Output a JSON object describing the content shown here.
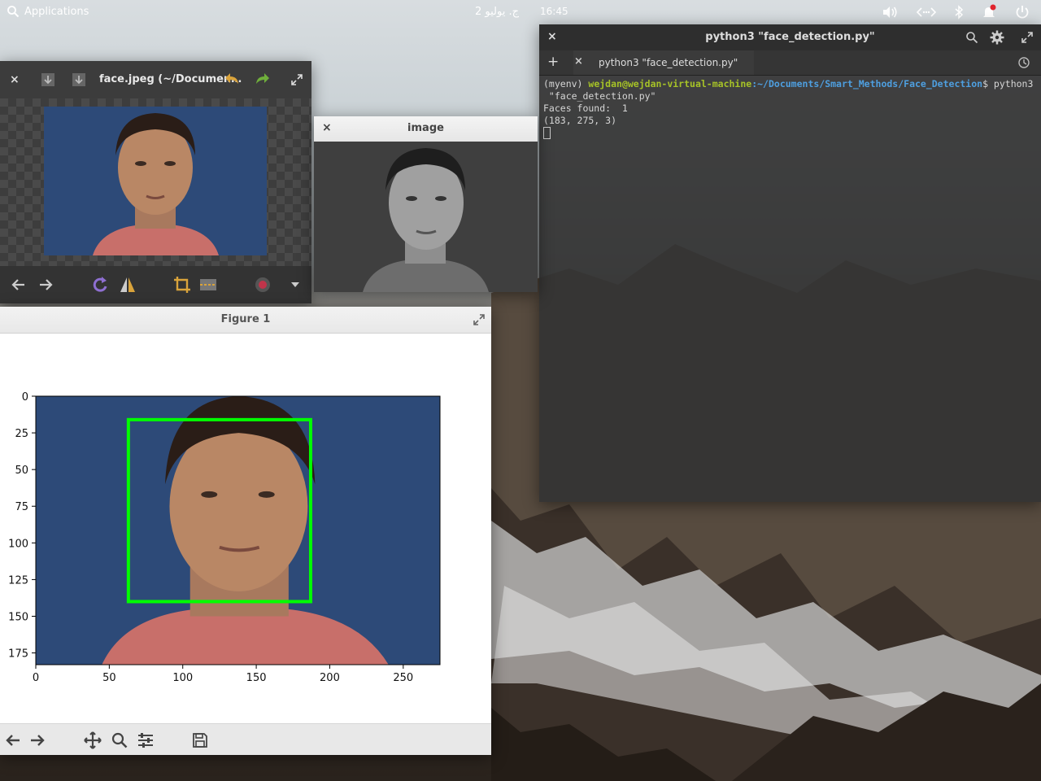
{
  "top_panel": {
    "applications_label": "Applications",
    "date": "ج. يوليو 2",
    "time": "16:45"
  },
  "terminal": {
    "title": "python3 \"face_detection.py\"",
    "tab_label": "python3 \"face_detection.py\"",
    "prompt_env": "(myenv)",
    "prompt_user": "wejdan@wejdan-virtual-machine",
    "prompt_path": ":~/Documents/Smart_Methods/Face_Detection",
    "prompt_cmd": "$ python3",
    "cmd_cont": " \"face_detection.py\"",
    "out1": "Faces found:  1",
    "out2": "(183, 275, 3)"
  },
  "viewer": {
    "title": "face.jpeg (~/Documen…"
  },
  "image_window": {
    "title": "image"
  },
  "figure": {
    "title": "Figure 1",
    "chart_data": {
      "type": "image",
      "xlim": [
        0,
        275
      ],
      "ylim": [
        183,
        0
      ],
      "xticks": [
        0,
        50,
        100,
        150,
        200,
        250
      ],
      "yticks": [
        0,
        25,
        50,
        75,
        100,
        125,
        150,
        175
      ],
      "xtick_labels": [
        "0",
        "50",
        "100",
        "150",
        "200",
        "250"
      ],
      "ytick_labels": [
        "0",
        "25",
        "50",
        "75",
        "100",
        "125",
        "150",
        "175"
      ],
      "detection_box": {
        "x0": 63,
        "y0": 16,
        "x1": 187,
        "y1": 140,
        "color": "#00ff00"
      }
    }
  },
  "colors": {
    "face_bg_blue": "#2d4a78",
    "detection_green": "#00ff00",
    "terminal_bg": "#343434",
    "prompt_green": "#a6c227",
    "prompt_blue": "#4e9fe0"
  }
}
